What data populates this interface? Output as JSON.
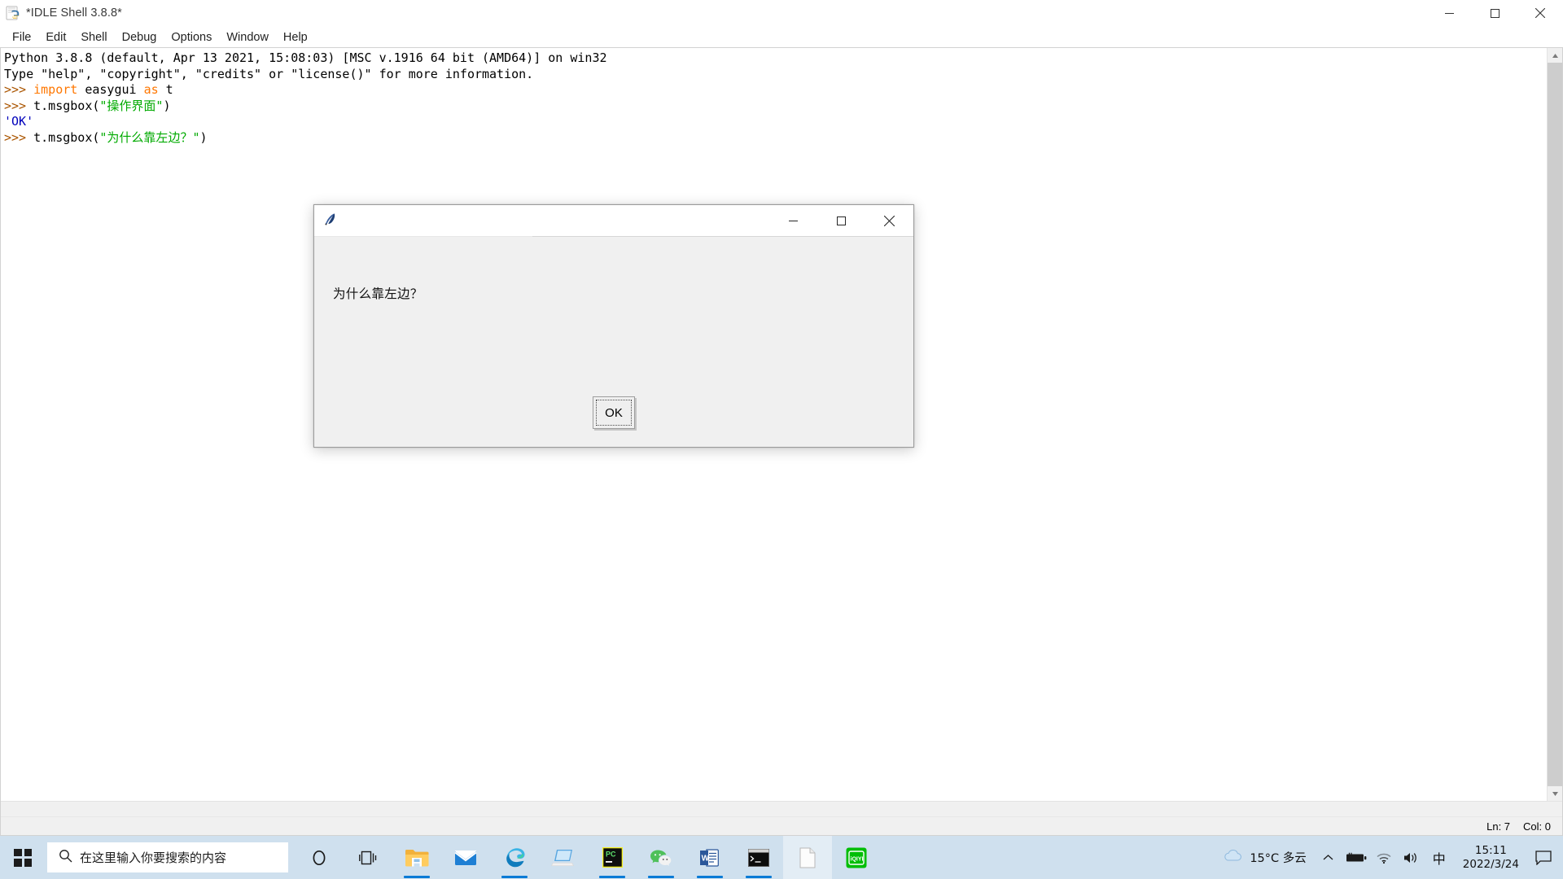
{
  "window": {
    "title": "*IDLE Shell 3.8.8*",
    "icon": "python-idle-icon",
    "controls": {
      "minimize": "─",
      "maximize": "☐",
      "close": "✕"
    },
    "menu": [
      "File",
      "Edit",
      "Shell",
      "Debug",
      "Options",
      "Window",
      "Help"
    ]
  },
  "shell": {
    "lines": [
      {
        "segments": [
          {
            "text": "Python 3.8.8 (default, Apr 13 2021, 15:08:03) [MSC v.1916 64 bit (AMD64)] on win32",
            "cls": "cl-plain"
          }
        ]
      },
      {
        "segments": [
          {
            "text": "Type \"help\", \"copyright\", \"credits\" or \"license()\" for more information.",
            "cls": "cl-plain"
          }
        ]
      },
      {
        "segments": [
          {
            "text": ">>> ",
            "cls": "cl-prompt"
          },
          {
            "text": "import",
            "cls": "cl-keyword"
          },
          {
            "text": " easygui ",
            "cls": "cl-plain"
          },
          {
            "text": "as",
            "cls": "cl-keyword"
          },
          {
            "text": " t",
            "cls": "cl-plain"
          }
        ]
      },
      {
        "segments": [
          {
            "text": ">>> ",
            "cls": "cl-prompt"
          },
          {
            "text": "t.msgbox(",
            "cls": "cl-plain"
          },
          {
            "text": "\"操作界面\"",
            "cls": "cl-string"
          },
          {
            "text": ")",
            "cls": "cl-plain"
          }
        ]
      },
      {
        "segments": [
          {
            "text": "'OK'",
            "cls": "cl-output"
          }
        ]
      },
      {
        "segments": [
          {
            "text": ">>> ",
            "cls": "cl-prompt"
          },
          {
            "text": "t.msgbox(",
            "cls": "cl-plain"
          },
          {
            "text": "\"为什么靠左边？\"",
            "cls": "cl-string"
          },
          {
            "text": ")",
            "cls": "cl-plain"
          }
        ]
      }
    ],
    "status": {
      "line": "Ln: 7",
      "col": "Col: 0"
    }
  },
  "dialog": {
    "title": "",
    "icon": "tkinter-feather-icon",
    "message": "为什么靠左边？",
    "ok_label": "OK",
    "controls": {
      "minimize": "─",
      "maximize": "☐",
      "close": "✕"
    }
  },
  "taskbar": {
    "start": "start-button",
    "search": {
      "placeholder": "在这里输入你要搜索的内容",
      "icon": "search-icon"
    },
    "items": [
      {
        "name": "cortana-icon",
        "glyph": "○",
        "running": false,
        "active": false
      },
      {
        "name": "task-view-icon",
        "glyph": "⌸",
        "running": false,
        "active": false
      },
      {
        "name": "file-explorer-icon",
        "glyph": "",
        "running": true,
        "active": false
      },
      {
        "name": "mail-icon",
        "glyph": "",
        "running": false,
        "active": false
      },
      {
        "name": "edge-icon",
        "glyph": "",
        "running": true,
        "active": false
      },
      {
        "name": "remote-desktop-icon",
        "glyph": "",
        "running": false,
        "active": false
      },
      {
        "name": "pycharm-icon",
        "glyph": "PC",
        "running": true,
        "active": false
      },
      {
        "name": "wechat-icon",
        "glyph": "",
        "running": true,
        "active": false
      },
      {
        "name": "word-icon",
        "glyph": "W",
        "running": true,
        "active": false
      },
      {
        "name": "terminal-icon",
        "glyph": "",
        "running": true,
        "active": false
      },
      {
        "name": "idle-document-icon",
        "glyph": "",
        "running": false,
        "active": true
      },
      {
        "name": "iqiyi-icon",
        "glyph": "iQIYI",
        "running": false,
        "active": false
      }
    ],
    "tray": {
      "weather_icon": "cloud-icon",
      "weather_text": "15°C 多云",
      "chevron": "∧",
      "battery": "battery-icon",
      "wifi": "wifi-icon",
      "volume": "volume-icon",
      "ime": "中",
      "time": "15:11",
      "date": "2022/3/24",
      "notification": "notification-icon"
    }
  },
  "colors": {
    "taskbar_bg": "#cfe0ee",
    "dialog_bg": "#f0f0f0",
    "accent": "#0a7bd6",
    "string_green": "#00aa00",
    "keyword_orange": "#ff7700",
    "prompt_brown": "#aa5500",
    "output_blue": "#0000bb"
  }
}
